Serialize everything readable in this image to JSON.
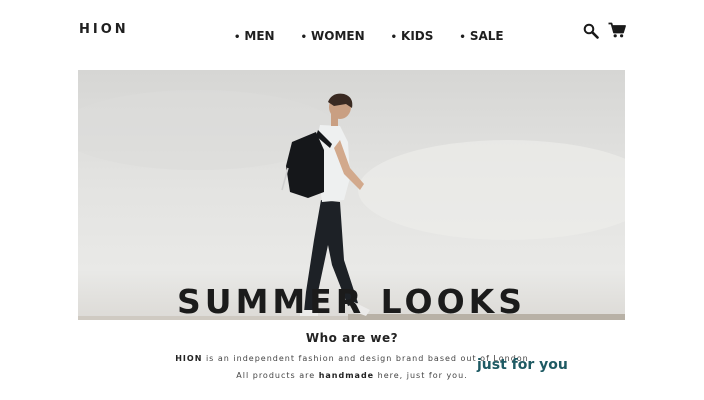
{
  "header": {
    "logo": "HION",
    "nav": [
      {
        "bullet": "•",
        "label": "MEN"
      },
      {
        "bullet": "•",
        "label": "WOMEN"
      },
      {
        "bullet": "•",
        "label": "KIDS"
      },
      {
        "bullet": "•",
        "label": "SALE"
      }
    ],
    "icons": [
      "search-icon",
      "cart-icon"
    ]
  },
  "hero": {
    "title": "SUMMER LOOKS"
  },
  "about": {
    "heading": "Who are we?",
    "line1": {
      "brand": "HION",
      "text": " is an independent fashion and design brand based out of London"
    },
    "line2": {
      "before": "All products are ",
      "emphasis": "handmade",
      "after": " here, just for you."
    },
    "accent": "just for you"
  },
  "colors": {
    "text": "#1f1f1f",
    "accent": "#1e5a63",
    "hero_sky": "#e3e3e1"
  }
}
